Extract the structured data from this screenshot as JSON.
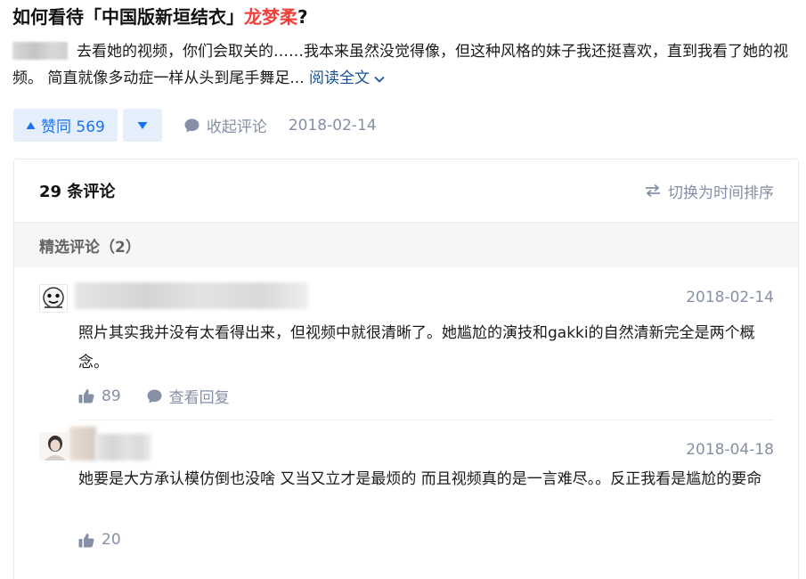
{
  "question": {
    "title_prefix": "如何看待「中国版新垣结衣」",
    "title_highlight": "龙梦柔",
    "title_suffix": "?",
    "highlight_color": "#f1403c"
  },
  "answer": {
    "excerpt": "去看她的视频，你们会取关的……我本来虽然没觉得像，但这种风格的妹子我还挺喜欢，直到我看了她的视频。 简直就像多动症一样从头到尾手舞足...",
    "read_more": "阅读全文",
    "upvote_label": "赞同 569",
    "collapse_comments": "收起评论",
    "date": "2018-02-14"
  },
  "comments_panel": {
    "count_label": "29 条评论",
    "sort_toggle": "切换为时间排序",
    "featured_label": "精选评论（2）",
    "comments": [
      {
        "date": "2018-02-14",
        "text": "照片其实我并没有太看得出来，但视频中就很清晰了。她尴尬的演技和gakki的自然清新完全是两个概念。",
        "likes": "89",
        "reply_label": "查看回复"
      },
      {
        "date": "2018-04-18",
        "text": "她要是大方承认模仿倒也没啥 又当又立才是最烦的 而且视频真的是一言难尽。。反正我看是尴尬的要命",
        "likes": "20"
      }
    ]
  },
  "colors": {
    "accent_blue": "#1772f6",
    "vote_bg": "#e5effc",
    "meta_gray": "#8590a6",
    "link_blue": "#175199"
  },
  "icons": [
    "triangle-up-icon",
    "triangle-down-icon",
    "comment-bubble-icon",
    "swap-arrows-icon",
    "thumbs-up-icon",
    "chevron-down-icon"
  ]
}
